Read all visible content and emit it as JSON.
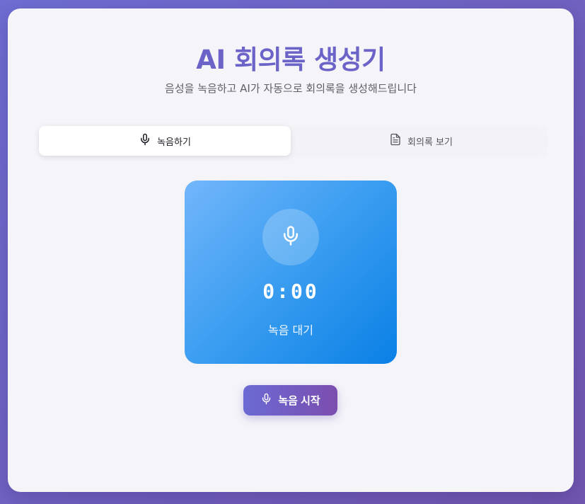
{
  "header": {
    "title": "AI 회의록 생성기",
    "subtitle": "음성을 녹음하고 AI가 자동으로 회의록을 생성해드립니다"
  },
  "tabs": [
    {
      "label": "녹음하기",
      "icon": "microphone-icon",
      "active": true
    },
    {
      "label": "회의록 보기",
      "icon": "document-icon",
      "active": false
    }
  ],
  "recorder": {
    "icon": "microphone-icon",
    "timer": "0:00",
    "status": "녹음 대기"
  },
  "actions": {
    "start_label": "녹음 시작",
    "start_icon": "microphone-icon"
  },
  "colors": {
    "background_start": "#6f6fd3",
    "background_end": "#7257b0",
    "title": "#6b63c8",
    "recorder_start": "#72b6fb",
    "recorder_end": "#0a80e6",
    "button_start": "#6b6ad4",
    "button_end": "#7b4eae"
  }
}
